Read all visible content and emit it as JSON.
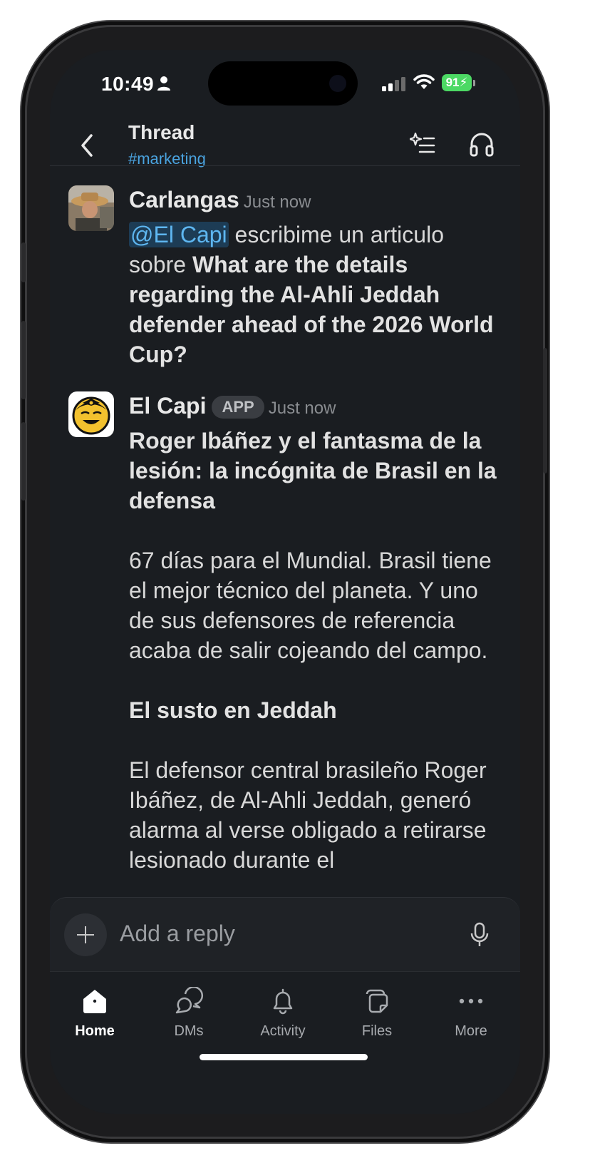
{
  "status_bar": {
    "time": "10:49",
    "battery": "91"
  },
  "header": {
    "title": "Thread",
    "channel": "#marketing"
  },
  "messages": [
    {
      "author": "Carlangas",
      "time": "Just now",
      "mention": "@El Capi",
      "text_plain": " escribime un articulo sobre ",
      "text_bold": "What are the details regarding the Al-Ahli Jeddah defender ahead of the 2026 World Cup?"
    },
    {
      "author": "El Capi",
      "badge": "APP",
      "time": "Just now",
      "headline": "Roger Ibáñez y el fantasma de la lesión: la incógnita de Brasil en la defensa",
      "para1": "67 días para el Mundial. Brasil tiene el mejor técnico del planeta. Y uno de sus defensores de referencia acaba de salir cojeando del campo.",
      "subheading": "El susto en Jeddah",
      "para2": "El defensor central brasileño Roger Ibáñez, de Al-Ahli Jeddah, generó alarma al verse obligado a retirarse lesionado durante el"
    }
  ],
  "composer": {
    "placeholder": "Add a reply"
  },
  "tabs": [
    {
      "label": "Home",
      "icon": "home-icon",
      "active": true
    },
    {
      "label": "DMs",
      "icon": "dms-icon",
      "active": false
    },
    {
      "label": "Activity",
      "icon": "bell-icon",
      "active": false
    },
    {
      "label": "Files",
      "icon": "files-icon",
      "active": false
    },
    {
      "label": "More",
      "icon": "more-icon",
      "active": false
    }
  ],
  "colors": {
    "background": "#1a1d21",
    "link": "#4aa3df",
    "mention_bg": "#1d3c55",
    "battery": "#4cd964"
  }
}
